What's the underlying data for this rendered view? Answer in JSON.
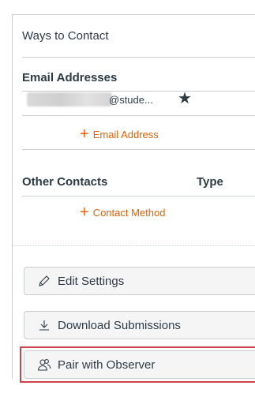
{
  "ways_to_contact": {
    "title": "Ways to Contact"
  },
  "email_section": {
    "title": "Email Addresses",
    "email_visible": "@stude...",
    "default_icon": "star-icon",
    "add_label": "Email Address"
  },
  "other_section": {
    "title": "Other Contacts",
    "type_label": "Type",
    "add_label": "Contact Method"
  },
  "actions": {
    "edit_settings": {
      "label": "Edit Settings",
      "icon": "pencil-icon"
    },
    "download_submissions": {
      "label": "Download Submissions",
      "icon": "download-icon"
    },
    "pair_with_observer": {
      "label": "Pair with Observer",
      "icon": "users-icon"
    }
  },
  "colors": {
    "accent": "#e66000",
    "text": "#2d3b45",
    "border": "#c7cdd1",
    "highlight": "#d0434a"
  }
}
